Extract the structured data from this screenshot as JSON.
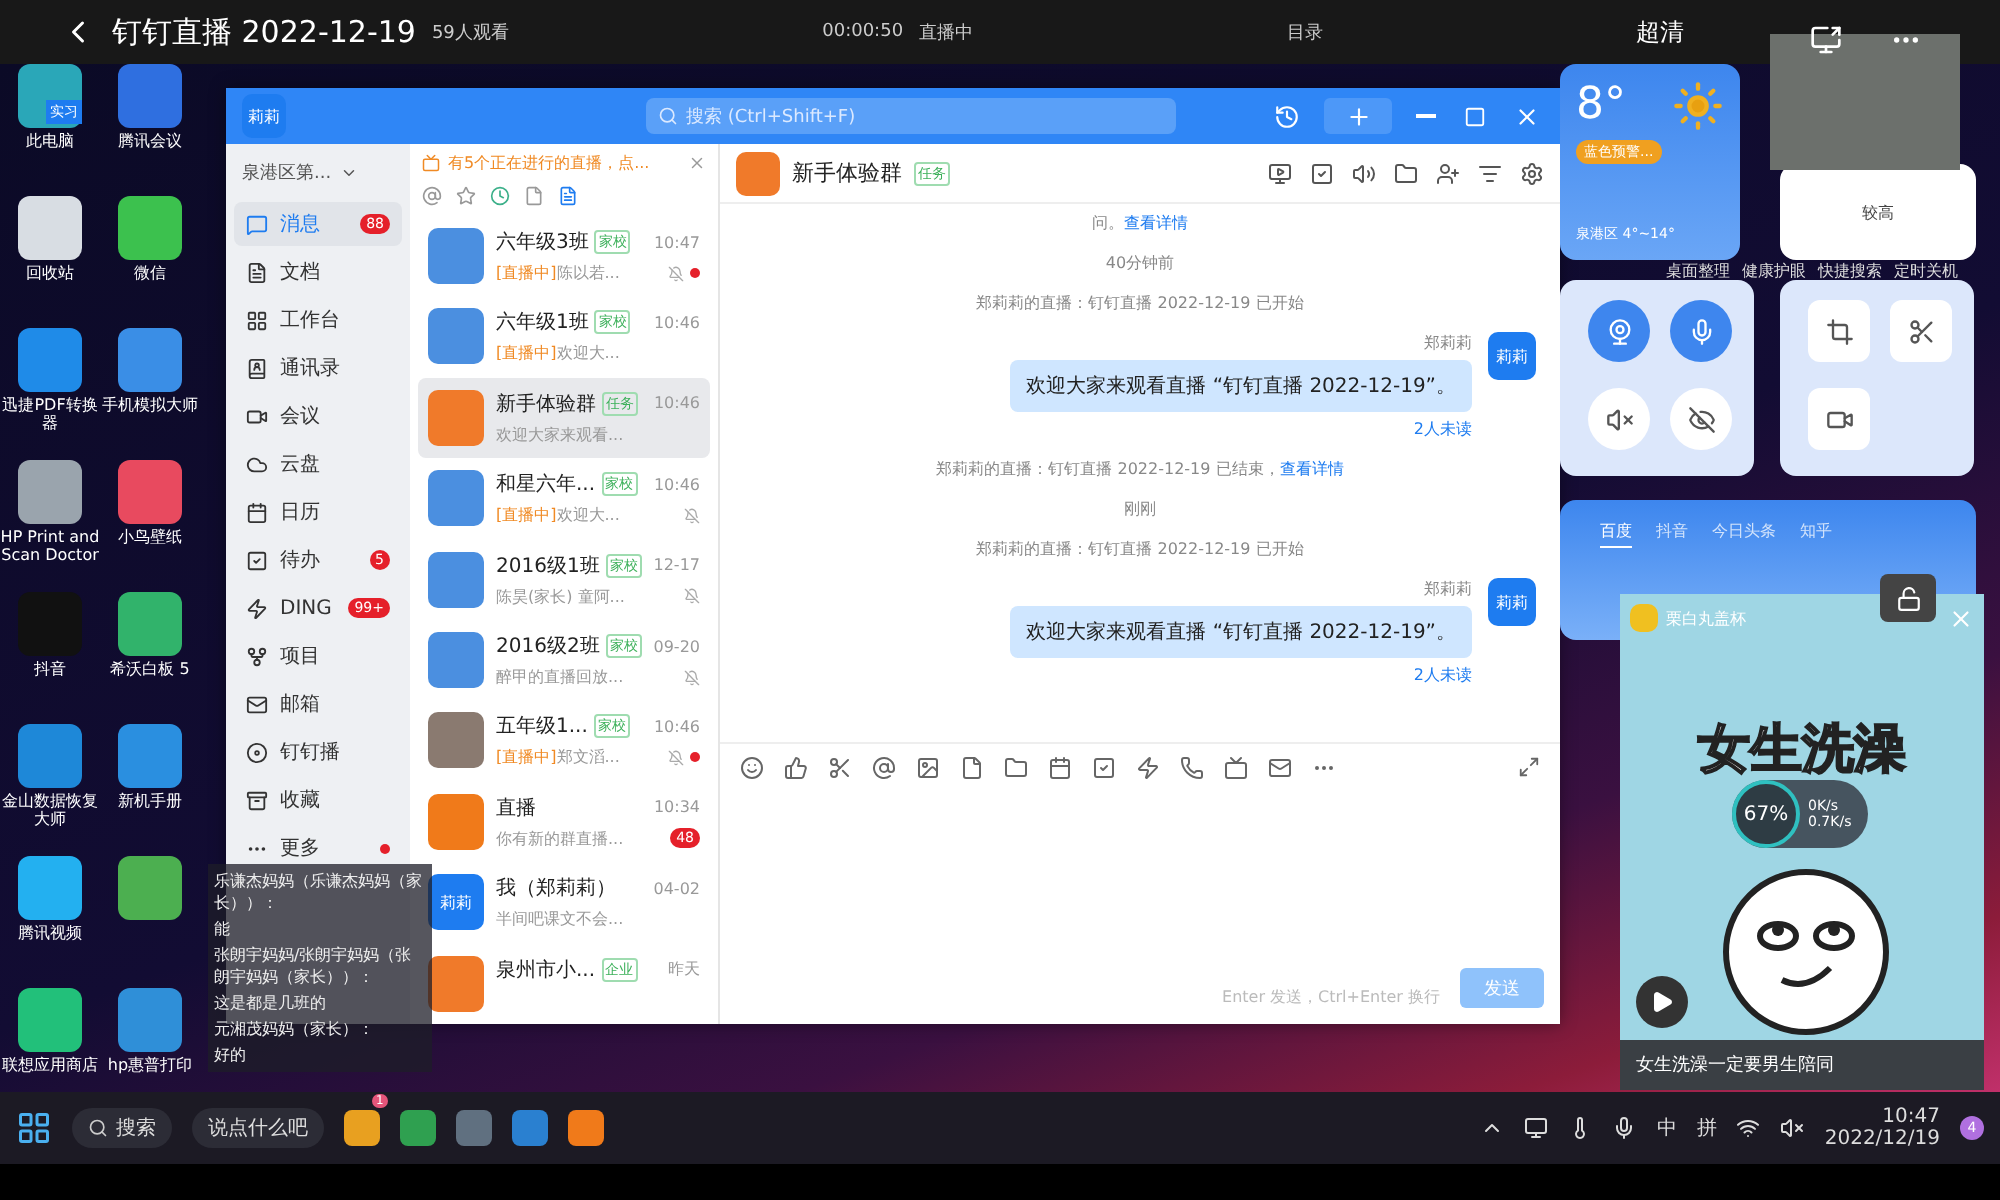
{
  "live_bar": {
    "title": "钉钉直播 2022-12-19",
    "viewers": "59人观看",
    "timer": "00:00:50",
    "status": "直播中",
    "catalog": "目录",
    "quality": "超清"
  },
  "desktop_icons": [
    {
      "label": "此电脑",
      "color": "#2aa7b8",
      "badge": "实习"
    },
    {
      "label": "腾讯会议",
      "color": "#2f6fe0"
    },
    {
      "label": "回收站",
      "color": "#d8dde3"
    },
    {
      "label": "微信",
      "color": "#3cc14e"
    },
    {
      "label": "迅捷PDF转换器",
      "color": "#1f8be8"
    },
    {
      "label": "手机模拟大师",
      "color": "#3a8ee6"
    },
    {
      "label": "HP Print and Scan Doctor",
      "color": "#9aa4ad"
    },
    {
      "label": "小鸟壁纸",
      "color": "#e84a5f"
    },
    {
      "label": "抖音",
      "color": "#111111"
    },
    {
      "label": "希沃白板 5",
      "color": "#31b36b"
    },
    {
      "label": "金山数据恢复大师",
      "color": "#1e88d8"
    },
    {
      "label": "新机手册",
      "color": "#2a8fe0"
    },
    {
      "label": "腾讯视频",
      "color": "#23b0f0"
    },
    {
      "color": "#4caf50"
    },
    {
      "label": "联想应用商店",
      "color": "#22c07a"
    },
    {
      "label": "hp惠普打印",
      "color": "#2f8fd8"
    }
  ],
  "comments": [
    {
      "name": "乐谦杰妈妈（乐谦杰妈妈（家长））：",
      "text": "能"
    },
    {
      "name": "张朗宇妈妈/张朗宇妈妈（张朗宇妈妈（家长））：",
      "text": "这是都是几班的"
    },
    {
      "name": "元湘茂妈妈（家长）：",
      "text": "好的"
    }
  ],
  "dingtalk": {
    "search": {
      "placeholder": "搜索 (Ctrl+Shift+F)"
    },
    "avatar": "莉莉",
    "org": "泉港区第...",
    "nav": [
      {
        "label": "消息",
        "selected": true,
        "badge": "88"
      },
      {
        "label": "文档",
        "selected": false
      },
      {
        "label": "工作台",
        "selected": false
      },
      {
        "label": "通讯录",
        "selected": false
      },
      {
        "label": "会议",
        "selected": false
      },
      {
        "label": "云盘",
        "selected": false
      },
      {
        "label": "日历",
        "selected": false
      },
      {
        "label": "待办",
        "selected": false,
        "badge": "5"
      },
      {
        "label": "DING",
        "selected": false,
        "badge": "99+"
      },
      {
        "label": "项目",
        "selected": false
      },
      {
        "label": "邮箱",
        "selected": false
      },
      {
        "label": "钉钉播",
        "selected": false
      },
      {
        "label": "收藏",
        "selected": false
      },
      {
        "label": "更多",
        "selected": false,
        "dot": true
      }
    ],
    "notice": "有5个正在进行的直播，点...",
    "conversations": [
      {
        "kind": "grid",
        "name": "六年级3班",
        "tag": "家校",
        "time": "10:47",
        "live": "[直播中]",
        "preview": "陈以若...",
        "muted": true,
        "dot": true,
        "selected": false
      },
      {
        "kind": "grid",
        "name": "六年级1班",
        "tag": "家校",
        "time": "10:46",
        "live": "[直播中]",
        "preview": "欢迎大...",
        "muted": false,
        "dot": false,
        "selected": false
      },
      {
        "kind": "orange",
        "name": "新手体验群",
        "tag": "任务",
        "time": "10:46",
        "preview": "欢迎大家来观看...",
        "muted": false,
        "dot": false,
        "selected": true
      },
      {
        "kind": "grid",
        "name": "和星六年...",
        "tag": "家校",
        "time": "10:46",
        "live": "[直播中]",
        "preview": "欢迎大...",
        "muted": true,
        "dot": false,
        "selected": false
      },
      {
        "kind": "grid",
        "name": "2016级1班",
        "tag": "家校",
        "time": "12-17",
        "preview": "陈昊(家长) 童阿...",
        "muted": true,
        "dot": false,
        "selected": false
      },
      {
        "kind": "grid",
        "name": "2016级2班",
        "tag": "家校",
        "time": "09-20",
        "preview": "醉甲的直播回放...",
        "muted": true,
        "dot": false,
        "selected": false
      },
      {
        "kind": "photo",
        "name": "五年级1...",
        "tag": "家校",
        "time": "10:46",
        "live": "[直播中]",
        "preview": "郑文滔...",
        "muted": true,
        "dot": true,
        "selected": false
      },
      {
        "kind": "tv",
        "name": "直播",
        "time": "10:34",
        "preview": "你有新的群直播...",
        "badge": "48",
        "muted": false,
        "dot": false,
        "selected": false
      },
      {
        "kind": "blue",
        "avatar": "莉莉",
        "name": "我（郑莉莉）",
        "time": "04-02",
        "preview": "半间吧课文不会...",
        "muted": false,
        "dot": false,
        "selected": false
      },
      {
        "kind": "orange",
        "name": "泉州市小...",
        "tag": "企业",
        "time": "昨天",
        "muted": false,
        "dot": false,
        "selected": false
      }
    ],
    "chat": {
      "title": "新手体验群",
      "tag": "任务",
      "messages": [
        {
          "kind": "system",
          "text": "问。",
          "link": "查看详情"
        },
        {
          "kind": "time",
          "text": "40分钟前"
        },
        {
          "kind": "system",
          "text": "郑莉莉的直播：钉钉直播 2022-12-19 已开始"
        },
        {
          "kind": "outgoing",
          "sender": "郑莉莉",
          "avatar": "莉莉",
          "text": "欢迎大家来观看直播 “钉钉直播 2022-12-19”。",
          "status": "2人未读"
        },
        {
          "kind": "system",
          "text": "郑莉莉的直播：钉钉直播 2022-12-19 已结束，",
          "link": "查看详情"
        },
        {
          "kind": "time",
          "text": "刚刚"
        },
        {
          "kind": "system",
          "text": "郑莉莉的直播：钉钉直播 2022-12-19 已开始"
        },
        {
          "kind": "outgoing",
          "sender": "郑莉莉",
          "avatar": "莉莉",
          "text": "欢迎大家来观看直播 “钉钉直播 2022-12-19”。",
          "status": "2人未读"
        }
      ],
      "input_placeholder": "Enter 发送，Ctrl+Enter 换行",
      "send": "发送"
    }
  },
  "widgets": {
    "weather": {
      "temp": "8°",
      "alert": "蓝色预警...",
      "location": "泉港区",
      "range": "4°~14°"
    },
    "meter": "较高",
    "tools": [
      "桌面整理",
      "健康护眼",
      "快捷搜索",
      "定时关机"
    ],
    "search_tabs": [
      {
        "label": "百度",
        "selected": true
      },
      {
        "label": "抖音",
        "selected": false
      },
      {
        "label": "今日头条",
        "selected": false
      },
      {
        "label": "知乎",
        "selected": false
      }
    ]
  },
  "video": {
    "channel": "栗白丸盖杯",
    "headline": "女生洗澡",
    "caption": "女生洗澡一定要男生陪同"
  },
  "speed": {
    "percent": "67%",
    "up": "0K/s",
    "down": "0.7K/s"
  },
  "taskbar": {
    "search": "搜索",
    "comment_placeholder": "说点什么吧",
    "app_badge": "1",
    "ime": [
      "中",
      "拼"
    ],
    "time": "10:47",
    "date": "2022/12/19",
    "notifications": "4"
  }
}
